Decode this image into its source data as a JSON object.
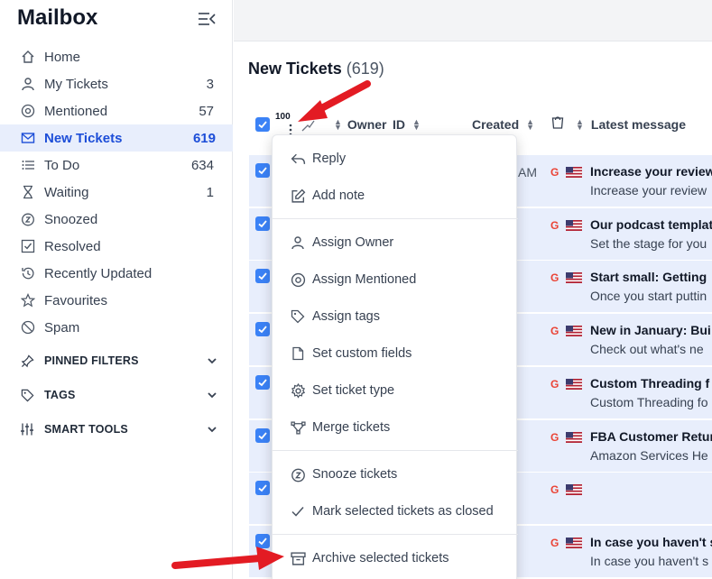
{
  "app": {
    "title": "Mailbox"
  },
  "sidebar": {
    "items": [
      {
        "label": "Home",
        "count": "",
        "icon": "home-icon"
      },
      {
        "label": "My Tickets",
        "count": "3",
        "icon": "user-icon"
      },
      {
        "label": "Mentioned",
        "count": "57",
        "icon": "at-icon"
      },
      {
        "label": "New Tickets",
        "count": "619",
        "icon": "mail-icon",
        "active": true
      },
      {
        "label": "To Do",
        "count": "634",
        "icon": "list-icon"
      },
      {
        "label": "Waiting",
        "count": "1",
        "icon": "hourglass-icon"
      },
      {
        "label": "Snoozed",
        "count": "",
        "icon": "snooze-icon"
      },
      {
        "label": "Resolved",
        "count": "",
        "icon": "check-square-icon"
      },
      {
        "label": "Recently Updated",
        "count": "",
        "icon": "history-icon"
      },
      {
        "label": "Favourites",
        "count": "",
        "icon": "star-icon"
      },
      {
        "label": "Spam",
        "count": "",
        "icon": "ban-icon"
      }
    ],
    "sections": [
      {
        "label": "PINNED FILTERS",
        "icon": "pin-icon"
      },
      {
        "label": "TAGS",
        "icon": "tag-icon"
      },
      {
        "label": "SMART TOOLS",
        "icon": "sliders-icon"
      }
    ]
  },
  "main": {
    "title": "New Tickets",
    "count": "(619)",
    "selected_count": "100",
    "columns": {
      "owner": "Owner",
      "id": "ID",
      "created": "Created",
      "latest": "Latest message"
    },
    "time_fragment": "AM",
    "rows": [
      {
        "subject": "Increase your review",
        "snippet": "Increase your review",
        "has_flag": true
      },
      {
        "subject": "Our podcast templat",
        "snippet": "Set the stage for you",
        "has_flag": true
      },
      {
        "subject": "Start small: Getting",
        "snippet": "Once you start puttin",
        "has_flag": true
      },
      {
        "subject": "New in January: Bui",
        "snippet": "Check out what's ne",
        "has_flag": true
      },
      {
        "subject": "Custom Threading f",
        "snippet": "Custom Threading fo",
        "has_flag": true
      },
      {
        "subject": "FBA Customer Retur",
        "snippet": "Amazon Services He",
        "has_flag": true
      },
      {
        "subject": "",
        "snippet": "",
        "has_flag": true
      },
      {
        "subject": "In case you haven't s",
        "snippet": "In case you haven't s",
        "has_flag": true
      }
    ]
  },
  "menu": {
    "groups": [
      [
        {
          "label": "Reply",
          "icon": "reply-icon"
        },
        {
          "label": "Add note",
          "icon": "edit-icon"
        }
      ],
      [
        {
          "label": "Assign Owner",
          "icon": "user-icon"
        },
        {
          "label": "Assign Mentioned",
          "icon": "at-icon"
        },
        {
          "label": "Assign tags",
          "icon": "tag-icon"
        },
        {
          "label": "Set custom fields",
          "icon": "file-icon"
        },
        {
          "label": "Set ticket type",
          "icon": "gear-icon"
        },
        {
          "label": "Merge tickets",
          "icon": "merge-icon"
        }
      ],
      [
        {
          "label": "Snooze tickets",
          "icon": "snooze-icon"
        },
        {
          "label": "Mark selected tickets as closed",
          "icon": "check-icon"
        }
      ],
      [
        {
          "label": "Archive selected tickets",
          "icon": "archive-icon"
        }
      ]
    ]
  },
  "colors": {
    "accent": "#1d4ed8",
    "selected_row": "#e8eefc",
    "annotation_arrow": "#e31b23"
  }
}
